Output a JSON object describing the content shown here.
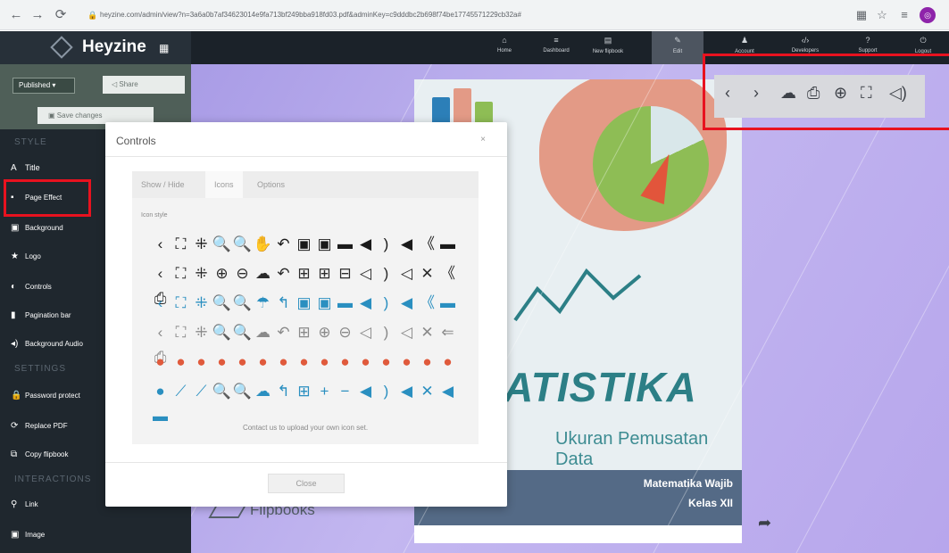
{
  "browser": {
    "url": "heyzine.com/admin/view?n=3a6a0b7af34623014e9fa713bf249bba918fd03.pdf&adminKey=c9dddbc2b698f74be17745571229cb32a#",
    "back_icon": "arrow-left-icon",
    "forward_icon": "arrow-right-icon",
    "reload_icon": "reload-icon"
  },
  "app": {
    "logo": "Heyzine"
  },
  "topnav": {
    "items": [
      {
        "label": "Home",
        "icon": "home-icon"
      },
      {
        "label": "Dashboard",
        "icon": "grid-icon"
      },
      {
        "label": "New flipbook",
        "icon": "document-icon"
      },
      {
        "label": "Edit",
        "icon": "pencil-icon"
      },
      {
        "label": "Account",
        "icon": "user-icon"
      },
      {
        "label": "Developers",
        "icon": "code-icon"
      },
      {
        "label": "Support",
        "icon": "question-icon"
      },
      {
        "label": "Logout",
        "icon": "power-icon"
      }
    ]
  },
  "sidebar": {
    "published": "Published ▾",
    "share": "Share",
    "save": "Save changes",
    "section_style": "STYLE",
    "section_settings": "SETTINGS",
    "section_interactions": "INTERACTIONS",
    "style_items": [
      {
        "label": "Title",
        "icon": "A"
      },
      {
        "label": "Page Effect",
        "icon": "▪"
      },
      {
        "label": "Background",
        "icon": "▣"
      },
      {
        "label": "Logo",
        "icon": "★"
      },
      {
        "label": "Controls",
        "icon": "◐"
      },
      {
        "label": "Pagination bar",
        "icon": "▮"
      },
      {
        "label": "Background Audio",
        "icon": "◂)"
      }
    ],
    "settings_items": [
      {
        "label": "Password protect",
        "icon": "🔒"
      },
      {
        "label": "Replace PDF",
        "icon": "⟳"
      },
      {
        "label": "Copy flipbook",
        "icon": "⧉"
      }
    ],
    "interaction_items": [
      {
        "label": "Link",
        "icon": "⚲"
      },
      {
        "label": "Image",
        "icon": "▣"
      }
    ]
  },
  "canvas": {
    "brand": "Flipbooks",
    "cover_title": "ATISTIKA",
    "cover_subtitle": "Ukuran Pemusatan Data",
    "cover_line1": "Matematika Wajib",
    "cover_line2": "Kelas XII",
    "toolbar_icons": [
      "‹",
      "›",
      "☁",
      "⎙",
      "⊕",
      "⛶",
      "◁)"
    ]
  },
  "dialog": {
    "title": "Controls",
    "close_x": "×",
    "tabs": [
      "Show / Hide",
      "Icons",
      "Options"
    ],
    "active_tab": "Icons",
    "icon_style_label": "Icon style",
    "icon_rows": [
      {
        "glyphs": "‹⛶⁜🔍🔍✋↶▣▣▬◀)◀《▬",
        "color": "#1a1a1a"
      },
      {
        "glyphs": "‹⛶⁜⊕⊖☁↶⊞⊞⊟◁)◁✕《⎙",
        "color": "#2a2a2a"
      },
      {
        "glyphs": "‹⛶⁜🔍🔍☂↰▣▣▬◀)◀《▬",
        "color": "#2a8fc0"
      },
      {
        "glyphs": "‹⛶⁜🔍🔍☁↶⊞⊕⊖◁)◁✕⇐⎙",
        "color": "#8a8a8a"
      },
      {
        "glyphs": "●●●●●●●●●●●●●●●",
        "color": "#e05a3c"
      },
      {
        "glyphs": "●⟋⟋🔍🔍☁↰⊞+−◀)◀✕◀▬",
        "color": "#2a8fc0"
      }
    ],
    "contact": "Contact us to upload your own icon set.",
    "close_label": "Close"
  }
}
